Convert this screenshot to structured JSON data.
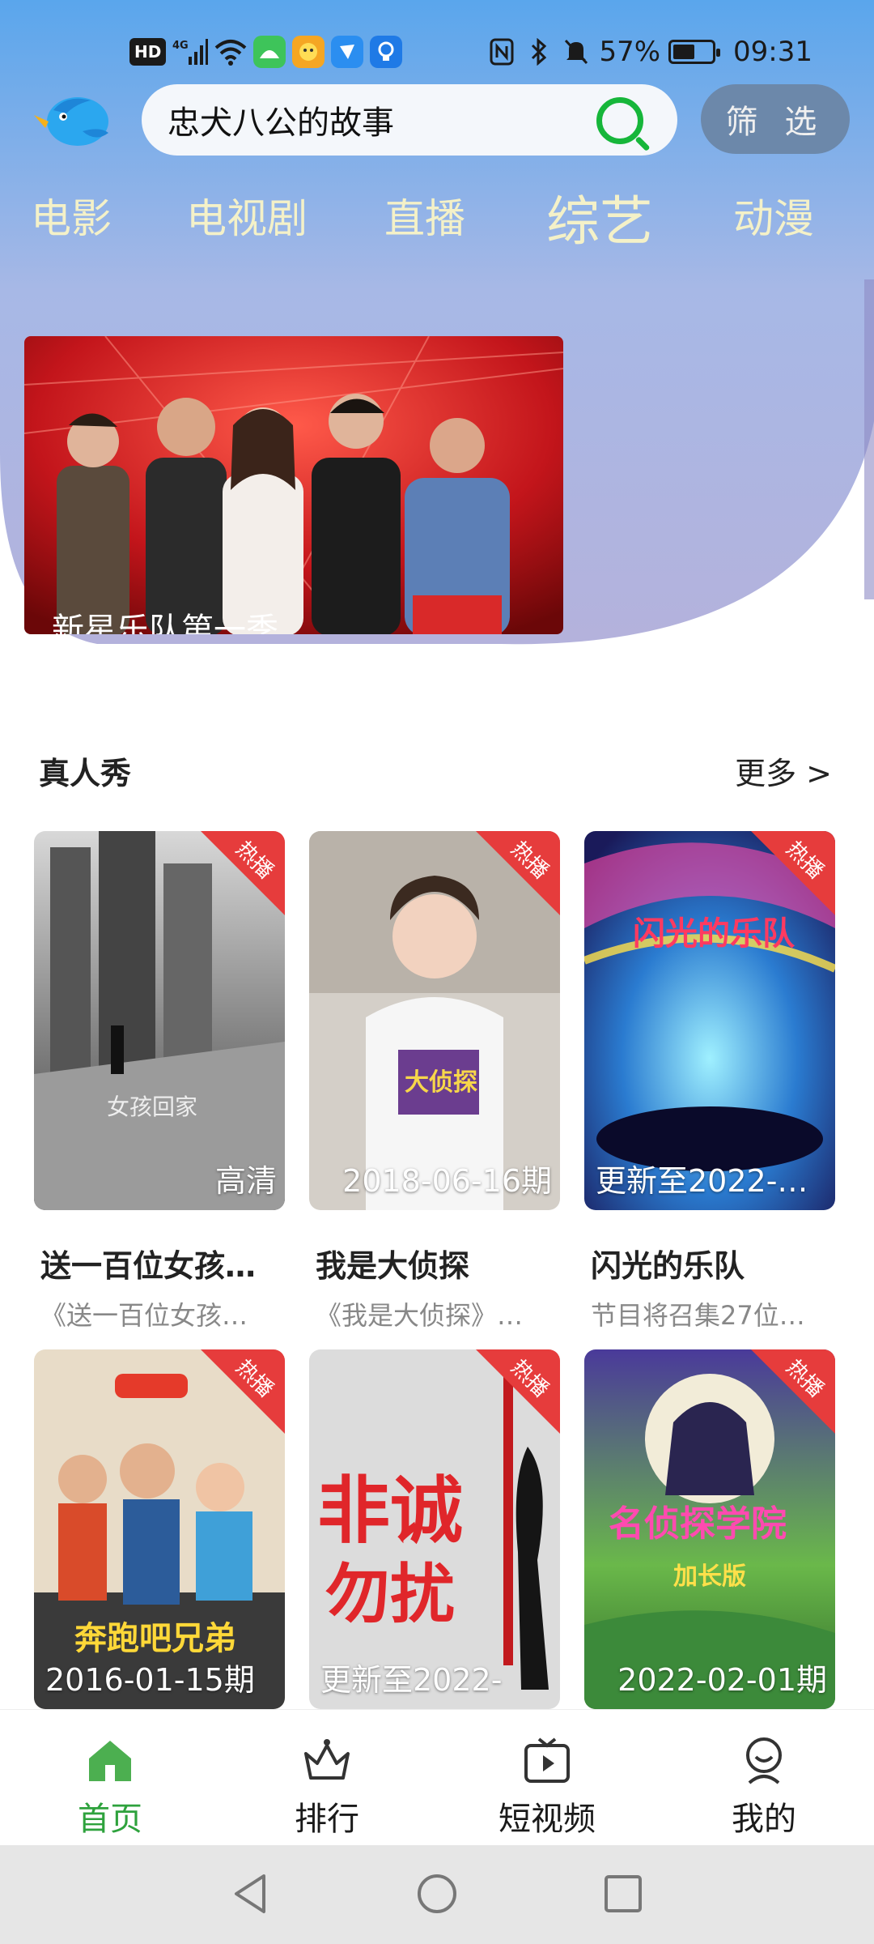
{
  "status_bar": {
    "hd": "HD",
    "network": "4G",
    "battery_percent": "57%",
    "battery_level": 0.57,
    "time": "09:31"
  },
  "search": {
    "query": "忠犬八公的故事",
    "filter_label": "筛 选"
  },
  "categories": [
    {
      "label": "电影",
      "active": false
    },
    {
      "label": "电视剧",
      "active": false
    },
    {
      "label": "直播",
      "active": false
    },
    {
      "label": "综艺",
      "active": true
    },
    {
      "label": "动漫",
      "active": false
    }
  ],
  "banner": {
    "caption": "新星乐队第一季"
  },
  "section": {
    "title": "真人秀",
    "more": "更多 >"
  },
  "hot_badge": "热播",
  "cards": [
    {
      "title": "送一百位女孩…",
      "desc": "《送一百位女孩…",
      "caption": "高清",
      "caption_align": "right"
    },
    {
      "title": "我是大侦探",
      "desc": "《我是大侦探》…",
      "caption": "2018-06-16期",
      "caption_align": "right"
    },
    {
      "title": "闪光的乐队",
      "desc": "节目将召集27位…",
      "caption": "更新至2022-…",
      "caption_align": "left"
    },
    {
      "title": "奔跑吧兄弟",
      "desc": "",
      "caption": "2016-01-15期",
      "caption_align": "left"
    },
    {
      "title": "非诚勿扰",
      "desc": "",
      "caption": "更新至2022-",
      "caption_align": "left"
    },
    {
      "title": "名侦探学院",
      "desc": "",
      "caption": "2022-02-01期",
      "caption_align": "right"
    }
  ],
  "bottom_nav": [
    {
      "label": "首页",
      "active": true
    },
    {
      "label": "排行",
      "active": false
    },
    {
      "label": "短视频",
      "active": false
    },
    {
      "label": "我的",
      "active": false
    }
  ],
  "colors": {
    "accent_green": "#2ea23d",
    "hot_red": "#e63c3c",
    "header_top": "#5aa6ec",
    "header_bottom": "#b4b2dc"
  }
}
